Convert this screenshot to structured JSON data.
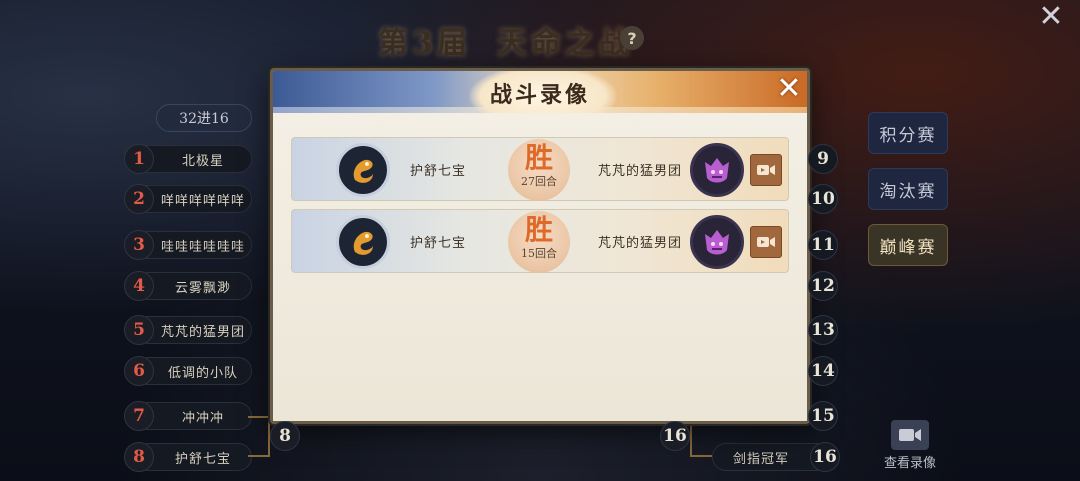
{
  "header": {
    "title_left": "第3届",
    "title_right": "天命之战",
    "help_icon": "question-circle-icon",
    "close_icon": "close-x-icon"
  },
  "round_tab": {
    "label": "32进16"
  },
  "left_bracket": [
    {
      "num": "1",
      "name": "北极星"
    },
    {
      "num": "2",
      "name": "咩咩咩咩咩咩"
    },
    {
      "num": "3",
      "name": "哇哇哇哇哇哇"
    },
    {
      "num": "4",
      "name": "云雾飘渺"
    },
    {
      "num": "5",
      "name": "芃芃的猛男团"
    },
    {
      "num": "6",
      "name": "低调的小队"
    },
    {
      "num": "7",
      "name": "冲冲冲"
    },
    {
      "num": "8",
      "name": "护舒七宝"
    }
  ],
  "left_winner_num": "8",
  "right_bracket": [
    {
      "num": "9"
    },
    {
      "num": "10"
    },
    {
      "num": "11"
    },
    {
      "num": "12"
    },
    {
      "num": "13"
    },
    {
      "num": "14"
    },
    {
      "num": "15"
    },
    {
      "num": "16",
      "name": "剑指冠军"
    }
  ],
  "right_winner_num": "16",
  "side_tabs": [
    {
      "label": "积分赛",
      "active": false
    },
    {
      "label": "淘汰赛",
      "active": false
    },
    {
      "label": "巅峰赛",
      "active": true
    }
  ],
  "view_replay": {
    "label": "查看录像",
    "icon": "video-camera-icon"
  },
  "modal": {
    "title": "战斗录像",
    "close_icon": "close-x-icon",
    "records": [
      {
        "left_player": "护舒七宝",
        "left_avatar": "golden-dragon-icon",
        "result": "胜",
        "rounds": "27回合",
        "right_player": "芃芃的猛男团",
        "right_avatar": "purple-beast-icon",
        "play_icon": "video-camera-icon"
      },
      {
        "left_player": "护舒七宝",
        "left_avatar": "golden-dragon-icon",
        "result": "胜",
        "rounds": "15回合",
        "right_player": "芃芃的猛男团",
        "right_avatar": "purple-beast-icon",
        "play_icon": "video-camera-icon"
      }
    ]
  },
  "colors": {
    "accent_red": "#e35b46",
    "win_orange": "#de6a2a",
    "play_button": "#a0683c"
  }
}
